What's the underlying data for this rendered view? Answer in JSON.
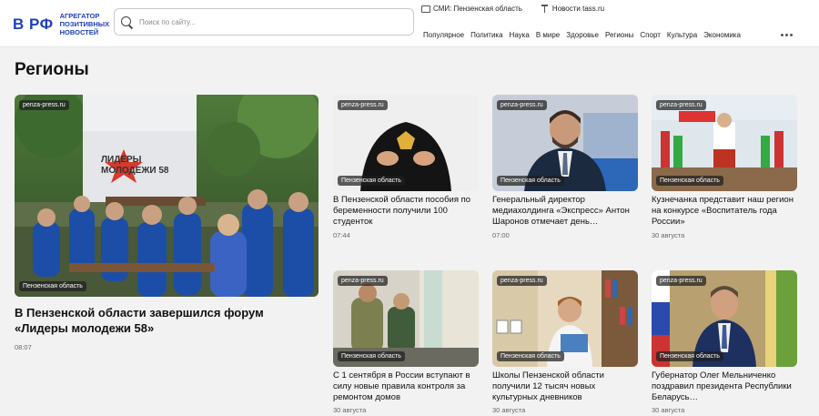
{
  "logo": {
    "mark": "В РФ",
    "text": "Агрегатор позитивных новостей"
  },
  "search": {
    "placeholder": "Поиск по сайту..."
  },
  "toplinks": [
    {
      "label": "СМИ: Пензенская область",
      "icon": "map-icon"
    },
    {
      "label": "Новости tass.ru",
      "icon": "pin-icon"
    }
  ],
  "nav": [
    "Популярное",
    "Политика",
    "Наука",
    "В мире",
    "Здоровье",
    "Регионы",
    "Спорт",
    "Культура",
    "Экономика"
  ],
  "page_title": "Регионы",
  "featured": {
    "source": "penza-press.ru",
    "region": "Пензенская область",
    "title": "В Пензенской области завершился форум «Лидеры молодежи 58»",
    "time": "08:07",
    "image_banner": "ЛИДЕРЫ МОЛОДЕЖИ 58"
  },
  "cards": [
    {
      "source": "penza-press.ru",
      "region": "Пензенская область",
      "title": "В Пензенской области пособия по беременности получили 100 студенток",
      "time": "07:44"
    },
    {
      "source": "penza-press.ru",
      "region": "Пензенская область",
      "title": "Генеральный директор медиахолдинга «Экспресс» Антон Шаронов отмечает день…",
      "time": "07:00"
    },
    {
      "source": "penza-press.ru",
      "region": "Пензенская область",
      "title": "Кузнечанка представит наш регион на конкурсе «Воспитатель года России»",
      "time": "30 августа"
    },
    {
      "source": "penza-press.ru",
      "region": "Пензенская область",
      "title": "С 1 сентября в России вступают в силу новые правила контроля за ремонтом домов",
      "time": "30 августа"
    },
    {
      "source": "penza-press.ru",
      "region": "Пензенская область",
      "title": "Школы Пензенской области получили 12 тысяч новых культурных дневников",
      "time": "30 августа"
    },
    {
      "source": "penza-press.ru",
      "region": "Пензенская область",
      "title": "Губернатор Олег Мельниченко поздравил президента Республики Беларусь…",
      "time": "30 августа"
    }
  ]
}
